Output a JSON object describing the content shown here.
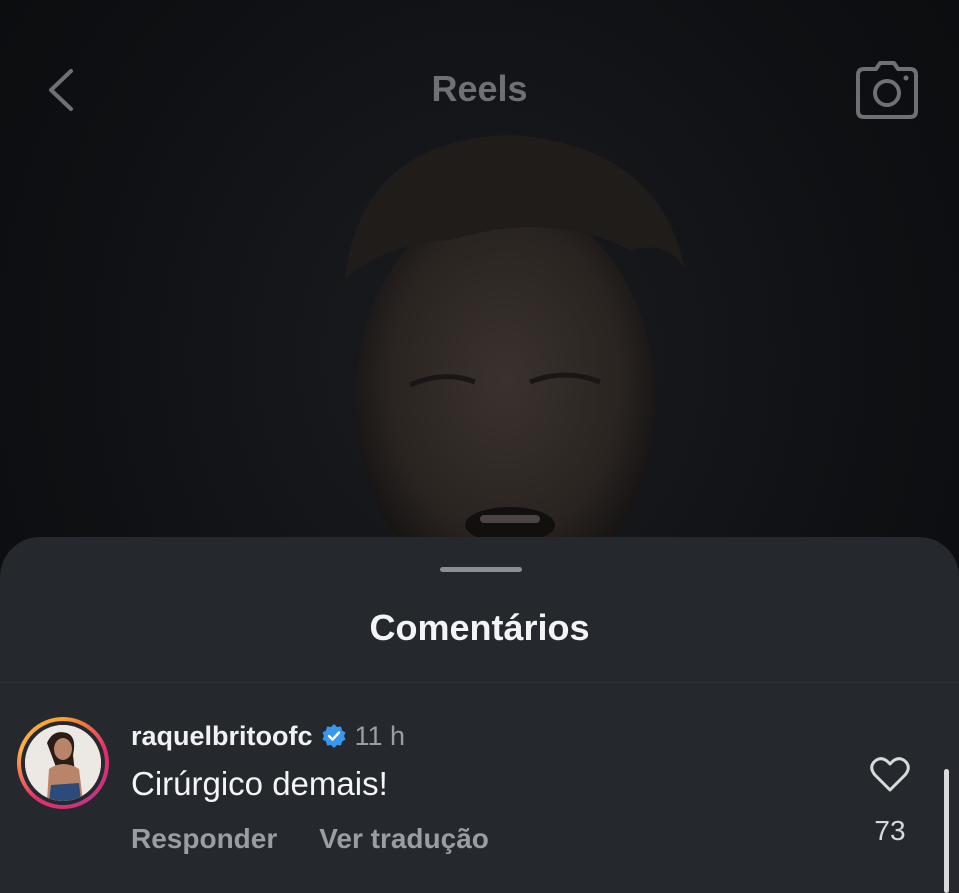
{
  "header": {
    "title": "Reels",
    "back_icon": "chevron-left-icon",
    "camera_icon": "camera-icon"
  },
  "comments_sheet": {
    "title": "Comentários",
    "comment": {
      "username": "raquelbritoofc",
      "verified": true,
      "time": "11 h",
      "text": "Cirúrgico demais!",
      "reply_label": "Responder",
      "translate_label": "Ver tradução",
      "like_count": "73"
    }
  },
  "colors": {
    "sheet_bg": "#25282d",
    "verified_blue": "#3897f0",
    "story_ring": "#e1306c"
  }
}
